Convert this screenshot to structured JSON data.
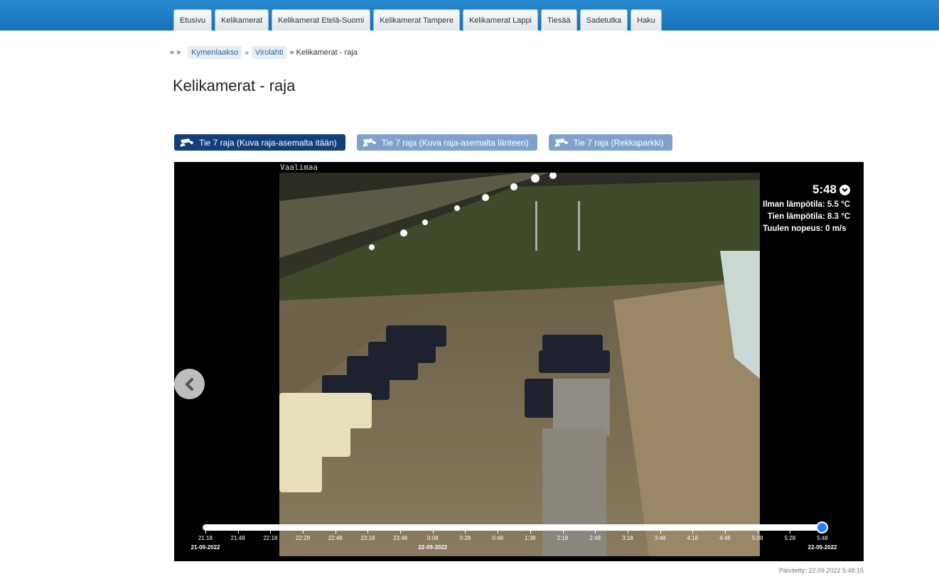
{
  "nav": {
    "tabs": [
      "Etusivu",
      "Kelikamerat",
      "Kelikamerat Etelä-Suomi",
      "Kelikamerat Tampere",
      "Kelikamerat Lappi",
      "Tiesää",
      "Sadetutka",
      "Haku"
    ]
  },
  "breadcrumb": {
    "prefix": "» »",
    "links": [
      "Kymenlaakso",
      "Virolahti"
    ],
    "separator": "»",
    "current": "» Kelikamerat - raja"
  },
  "page": {
    "title": "Kelikamerat - raja"
  },
  "camera_tabs": [
    {
      "label": "Tie 7 raja (Kuva raja-asemalta itään)",
      "active": true
    },
    {
      "label": "Tie 7 raja (Kuva raja-asemalta länteen)",
      "active": false
    },
    {
      "label": "Tie 7 raja (Rekkaparkki)",
      "active": false
    }
  ],
  "viewer": {
    "camera_label": "Vaalimaa",
    "time": "5:48",
    "air_temp": "Ilman lämpötila: 5.5 °C",
    "road_temp": "Tien lämpötila: 8.3 °C",
    "wind": "Tuulen nopeus: 0 m/s",
    "slider_position": 1.0,
    "ticks": [
      "21:18",
      "21:48",
      "22:18",
      "22:28",
      "22:48",
      "23:18",
      "23:48",
      "0:08",
      "0:28",
      "0:48",
      "1:38",
      "2:18",
      "2:48",
      "3:18",
      "3:48",
      "4:18",
      "4:48",
      "5:08",
      "5:28",
      "5:48"
    ],
    "dates": [
      {
        "label": "21-09-2022",
        "tick": 0
      },
      {
        "label": "22-09-2022",
        "tick": 7
      },
      {
        "label": "22-09-2022",
        "tick": 19
      }
    ]
  },
  "footer": {
    "updated": "Päivitetty: 22.09.2022 5:48:15"
  },
  "colors": {
    "nav_bar": "#1671b8",
    "active_tab": "#123f79",
    "inactive_tab": "#7fa2cc",
    "slider_handle": "#2a7fff"
  }
}
